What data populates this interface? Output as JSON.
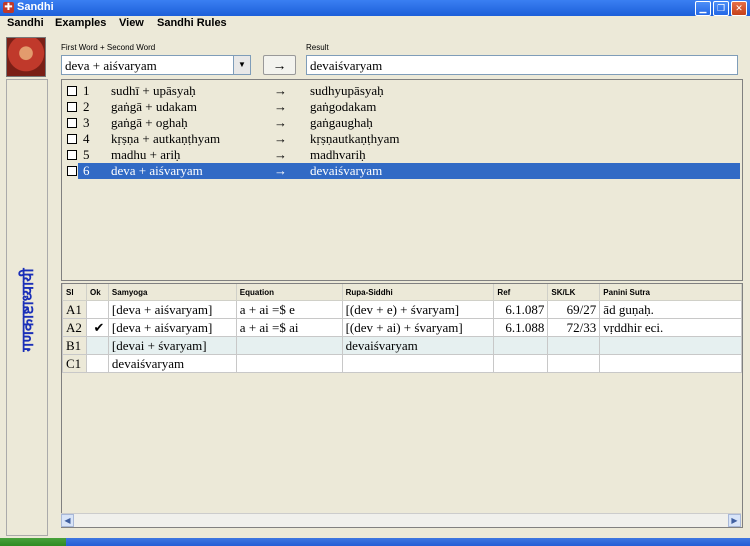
{
  "window": {
    "title": "Sandhi",
    "app_icon": "shield-cross-icon"
  },
  "menu": [
    "Sandhi",
    "Examples",
    "View",
    "Sandhi Rules"
  ],
  "sidebar": {
    "label": "गणकाष्टाध्यायी"
  },
  "input": {
    "label": "First Word + Second Word",
    "value": "deva + aiśvaryam",
    "go_label": "→"
  },
  "result": {
    "label": "Result",
    "value": "devaiśvaryam"
  },
  "examples": [
    {
      "n": "1",
      "input": "sudhī + upāsyaḥ",
      "arrow": "→",
      "output": "sudhyupāsyaḥ",
      "selected": false
    },
    {
      "n": "2",
      "input": "gaṅgā + udakam",
      "arrow": "→",
      "output": "gaṅgodakam",
      "selected": false
    },
    {
      "n": "3",
      "input": "gaṅgā + oghaḥ",
      "arrow": "→",
      "output": "gaṅgaughaḥ",
      "selected": false
    },
    {
      "n": "4",
      "input": "kṛṣṇa + autkaṇṭhyam",
      "arrow": "→",
      "output": "kṛṣṇautkaṇṭhyam",
      "selected": false
    },
    {
      "n": "5",
      "input": "madhu + ariḥ",
      "arrow": "→",
      "output": "madhvariḥ",
      "selected": false
    },
    {
      "n": "6",
      "input": "deva + aiśvaryam",
      "arrow": "→",
      "output": "devaiśvaryam",
      "selected": true
    }
  ],
  "table": {
    "headers": [
      "Sl",
      "Ok",
      "Samyoga",
      "Equation",
      "Rupa-Siddhi",
      "Ref",
      "SK/LK",
      "Panini Sutra"
    ],
    "rows": [
      {
        "sl": "A1",
        "ok": "",
        "samyoga": "[deva  +  aiśvaryam]",
        "equation": "a  +  ai    =$    e",
        "rupa": "[(dev  +  e)  +  śvaryam]",
        "ref": "6.1.087",
        "sklk": "69/27",
        "sutra": "ād  guṇaḥ."
      },
      {
        "sl": "A2",
        "ok": "✔",
        "samyoga": "[deva  +  aiśvaryam]",
        "equation": "a  +  ai    =$    ai",
        "rupa": "[(dev  +  ai)  +  śvaryam]",
        "ref": "6.1.088",
        "sklk": "72/33",
        "sutra": "vṛddhir  eci."
      },
      {
        "sl": "B1",
        "ok": "",
        "samyoga": "[devai  +  śvaryam]",
        "equation": "",
        "rupa": "devaiśvaryam",
        "ref": "",
        "sklk": "",
        "sutra": ""
      },
      {
        "sl": "C1",
        "ok": "",
        "samyoga": "devaiśvaryam",
        "equation": "",
        "rupa": "",
        "ref": "",
        "sklk": "",
        "sutra": ""
      }
    ]
  },
  "colors": {
    "selection": "#316ac5",
    "titlebar": "#2a6ae8",
    "sidebar_text": "#1a2fb8"
  }
}
